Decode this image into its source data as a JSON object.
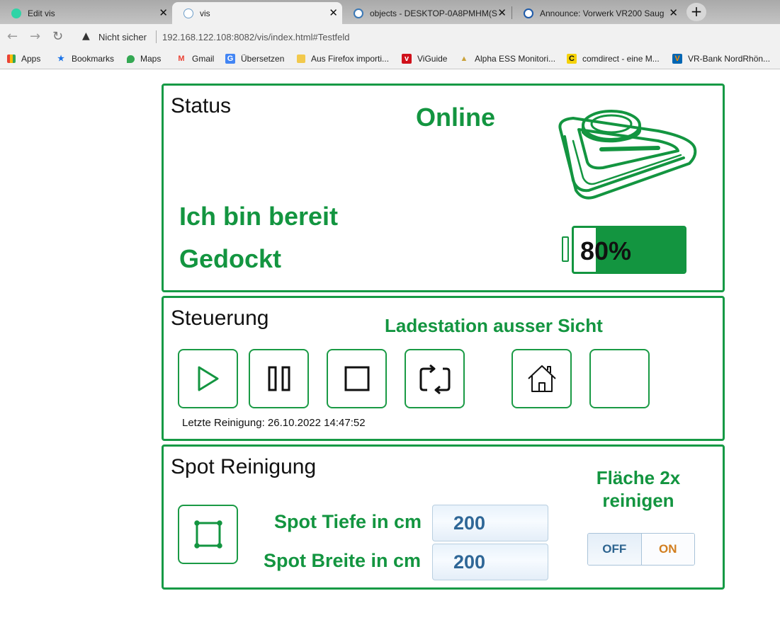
{
  "browser": {
    "tabs": [
      {
        "title": "Edit vis",
        "icon": "iobroker-edit-icon"
      },
      {
        "title": "vis",
        "icon": "vis-icon"
      },
      {
        "title": "objects - DESKTOP-0A8PMHM(S",
        "icon": "iobroker-objects-icon"
      },
      {
        "title": "Announce: Vorwerk VR200 Saug",
        "icon": "forum-icon"
      }
    ],
    "security_label": "Nicht sicher",
    "url": "192.168.122.108:8082/vis/index.html#Testfeld",
    "bookmarks": [
      {
        "label": "Apps",
        "color": "#4285f4"
      },
      {
        "label": "Bookmarks",
        "color": "#1a73e8"
      },
      {
        "label": "Maps",
        "color": "#34a853"
      },
      {
        "label": "Gmail",
        "color": "#ea4335"
      },
      {
        "label": "Übersetzen",
        "color": "#4285f4"
      },
      {
        "label": "Aus Firefox importi...",
        "color": "#f2c94c"
      },
      {
        "label": "ViGuide",
        "color": "#d0111b"
      },
      {
        "label": "Alpha ESS Monitori...",
        "color": "#caa23a"
      },
      {
        "label": "comdirect - eine M...",
        "color": "#f5d20a"
      },
      {
        "label": "VR-Bank NordRhön...",
        "color": "#0066b3"
      }
    ]
  },
  "status": {
    "title": "Status",
    "state": "Online",
    "message": "Ich bin bereit",
    "dock": "Gedockt",
    "battery_percent": 80,
    "battery_label": "80%"
  },
  "control": {
    "title": "Steuerung",
    "notice": "Ladestation ausser Sicht",
    "last_clean": "Letzte Reinigung: 26.10.2022 14:47:52"
  },
  "spot": {
    "title": "Spot Reinigung",
    "depth_label": "Spot Tiefe in cm",
    "depth_value": "200",
    "width_label": "Spot Breite in cm",
    "width_value": "200",
    "double_label": "Fläche 2x reinigen",
    "toggle_off": "OFF",
    "toggle_on": "ON",
    "toggle_state": "ON"
  },
  "colors": {
    "accent_green": "#139540",
    "toggle_blue": "#2d6490",
    "toggle_orange": "#d27e1f"
  }
}
